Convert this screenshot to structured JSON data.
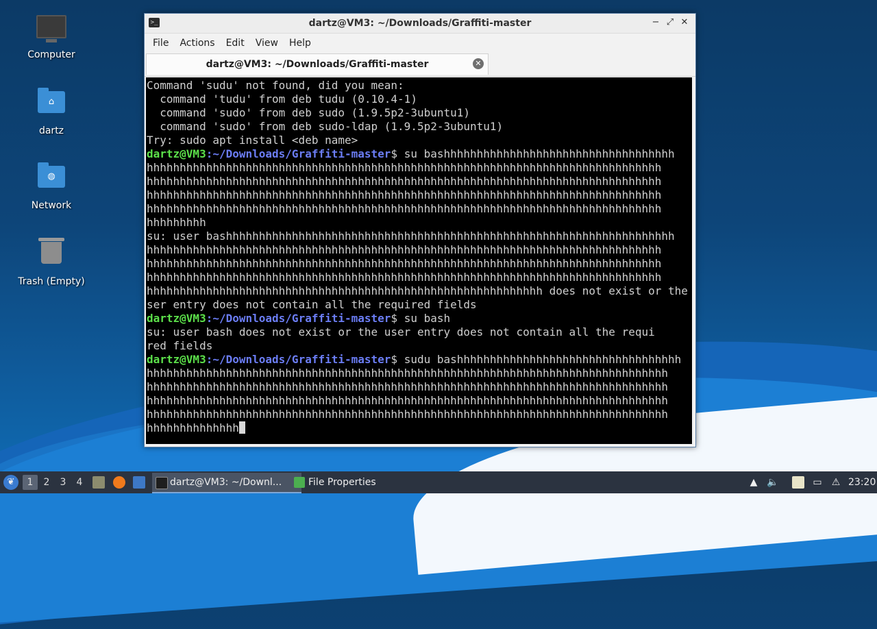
{
  "desktop": {
    "icons": [
      {
        "label": "Computer",
        "icon": "computer-icon"
      },
      {
        "label": "dartz",
        "icon": "home-folder-icon"
      },
      {
        "label": "Network",
        "icon": "network-folder-icon"
      },
      {
        "label": "Trash (Empty)",
        "icon": "trash-icon"
      }
    ]
  },
  "window": {
    "title": "dartz@VM3: ~/Downloads/Graffiti-master",
    "menu": [
      "File",
      "Actions",
      "Edit",
      "View",
      "Help"
    ],
    "tab_label": "dartz@VM3: ~/Downloads/Graffiti-master",
    "close_glyph": "✕",
    "min_glyph": "−",
    "max_glyph": "⤢"
  },
  "terminal": {
    "prompt_user": "dartz@VM3",
    "prompt_path": ":~/Downloads/Graffiti-master",
    "lines": [
      {
        "text": "Command 'sudu' not found, did you mean:"
      },
      {
        "text": "  command 'tudu' from deb tudu (0.10.4-1)"
      },
      {
        "text": "  command 'sudo' from deb sudo (1.9.5p2-3ubuntu1)"
      },
      {
        "text": "  command 'sudo' from deb sudo-ldap (1.9.5p2-3ubuntu1)"
      },
      {
        "text": "Try: sudo apt install <deb name>"
      },
      {
        "prompt": true,
        "text": "$ su bashhhhhhhhhhhhhhhhhhhhhhhhhhhhhhhhhhh"
      },
      {
        "text": "hhhhhhhhhhhhhhhhhhhhhhhhhhhhhhhhhhhhhhhhhhhhhhhhhhhhhhhhhhhhhhhhhhhhhhhhhhhhhh"
      },
      {
        "text": "hhhhhhhhhhhhhhhhhhhhhhhhhhhhhhhhhhhhhhhhhhhhhhhhhhhhhhhhhhhhhhhhhhhhhhhhhhhhhh"
      },
      {
        "text": "hhhhhhhhhhhhhhhhhhhhhhhhhhhhhhhhhhhhhhhhhhhhhhhhhhhhhhhhhhhhhhhhhhhhhhhhhhhhhh"
      },
      {
        "text": "hhhhhhhhhhhhhhhhhhhhhhhhhhhhhhhhhhhhhhhhhhhhhhhhhhhhhhhhhhhhhhhhhhhhhhhhhhhhhh"
      },
      {
        "text": "hhhhhhhhh"
      },
      {
        "text": "su: user bashhhhhhhhhhhhhhhhhhhhhhhhhhhhhhhhhhhhhhhhhhhhhhhhhhhhhhhhhhhhhhhhhhhh"
      },
      {
        "text": "hhhhhhhhhhhhhhhhhhhhhhhhhhhhhhhhhhhhhhhhhhhhhhhhhhhhhhhhhhhhhhhhhhhhhhhhhhhhhh"
      },
      {
        "text": "hhhhhhhhhhhhhhhhhhhhhhhhhhhhhhhhhhhhhhhhhhhhhhhhhhhhhhhhhhhhhhhhhhhhhhhhhhhhhh"
      },
      {
        "text": "hhhhhhhhhhhhhhhhhhhhhhhhhhhhhhhhhhhhhhhhhhhhhhhhhhhhhhhhhhhhhhhhhhhhhhhhhhhhhh"
      },
      {
        "text": "hhhhhhhhhhhhhhhhhhhhhhhhhhhhhhhhhhhhhhhhhhhhhhhhhhhhhhhhhhhh does not exist or the u"
      },
      {
        "text": "ser entry does not contain all the required fields"
      },
      {
        "prompt": true,
        "text": "$ su bash"
      },
      {
        "text": "su: user bash does not exist or the user entry does not contain all the requi"
      },
      {
        "text": "red fields"
      },
      {
        "prompt": true,
        "text": "$ sudu bashhhhhhhhhhhhhhhhhhhhhhhhhhhhhhhhhh"
      },
      {
        "text": "hhhhhhhhhhhhhhhhhhhhhhhhhhhhhhhhhhhhhhhhhhhhhhhhhhhhhhhhhhhhhhhhhhhhhhhhhhhhhhh"
      },
      {
        "text": "hhhhhhhhhhhhhhhhhhhhhhhhhhhhhhhhhhhhhhhhhhhhhhhhhhhhhhhhhhhhhhhhhhhhhhhhhhhhhhh"
      },
      {
        "text": "hhhhhhhhhhhhhhhhhhhhhhhhhhhhhhhhhhhhhhhhhhhhhhhhhhhhhhhhhhhhhhhhhhhhhhhhhhhhhhh"
      },
      {
        "text": "hhhhhhhhhhhhhhhhhhhhhhhhhhhhhhhhhhhhhhhhhhhhhhhhhhhhhhhhhhhhhhhhhhhhhhhhhhhhhhh"
      },
      {
        "text": "hhhhhhhhhhhhhh",
        "cursor": true
      }
    ]
  },
  "taskbar": {
    "workspaces": [
      "1",
      "2",
      "3",
      "4"
    ],
    "active_workspace": "1",
    "tasks": [
      {
        "label": "dartz@VM3: ~/Downl...",
        "icon": "terminal-icon",
        "active": true
      },
      {
        "label": "File Properties",
        "icon": "file-properties-icon",
        "active": false
      }
    ],
    "clock": "23:20"
  },
  "colors": {
    "prompt_user": "#5ce04a",
    "prompt_path": "#6b7df5",
    "terminal_bg": "#000000",
    "taskbar_bg": "#2b3340"
  }
}
